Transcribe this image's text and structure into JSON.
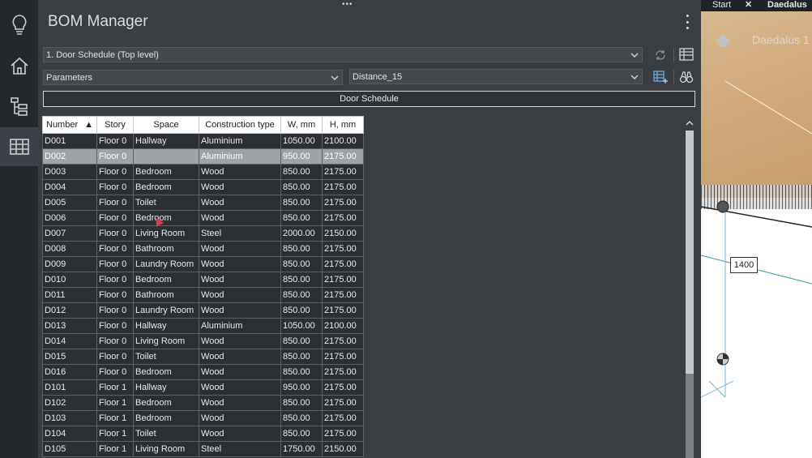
{
  "panel": {
    "title": "BOM Manager"
  },
  "leftbar": {
    "items": [
      {
        "icon": "lightbulb-icon"
      },
      {
        "icon": "home-icon"
      },
      {
        "icon": "tree-icon"
      },
      {
        "icon": "table-icon",
        "active": true
      }
    ]
  },
  "toolbar": {
    "bom_select": "1. Door Schedule (Top level)",
    "param_select": "Parameters",
    "distance_select": "Distance_15",
    "schedule_button": "Door Schedule"
  },
  "table": {
    "columns": [
      "Number",
      "Story",
      "Space",
      "Construction type",
      "W, mm",
      "H, mm"
    ],
    "sort_indicator": "▲",
    "rows": [
      [
        "D001",
        "Floor 0",
        "Hallway",
        "Aluminium",
        "1050.00",
        "2100.00"
      ],
      [
        "D002",
        "Floor 0",
        "",
        "Aluminium",
        "950.00",
        "2175.00"
      ],
      [
        "D003",
        "Floor 0",
        "Bedroom",
        "Wood",
        "850.00",
        "2175.00"
      ],
      [
        "D004",
        "Floor 0",
        "Bedroom",
        "Wood",
        "850.00",
        "2175.00"
      ],
      [
        "D005",
        "Floor 0",
        "Toilet",
        "Wood",
        "850.00",
        "2175.00"
      ],
      [
        "D006",
        "Floor 0",
        "Bedroom",
        "Wood",
        "850.00",
        "2175.00"
      ],
      [
        "D007",
        "Floor 0",
        "Living Room",
        "Steel",
        "2000.00",
        "2150.00"
      ],
      [
        "D008",
        "Floor 0",
        "Bathroom",
        "Wood",
        "850.00",
        "2175.00"
      ],
      [
        "D009",
        "Floor 0",
        "Laundry Room",
        "Wood",
        "850.00",
        "2175.00"
      ],
      [
        "D010",
        "Floor 0",
        "Bedroom",
        "Wood",
        "850.00",
        "2175.00"
      ],
      [
        "D011",
        "Floor 0",
        "Bathroom",
        "Wood",
        "850.00",
        "2175.00"
      ],
      [
        "D012",
        "Floor 0",
        "Laundry Room",
        "Wood",
        "850.00",
        "2175.00"
      ],
      [
        "D013",
        "Floor 0",
        "Hallway",
        "Aluminium",
        "1050.00",
        "2100.00"
      ],
      [
        "D014",
        "Floor 0",
        "Living Room",
        "Wood",
        "850.00",
        "2175.00"
      ],
      [
        "D015",
        "Floor 0",
        "Toilet",
        "Wood",
        "850.00",
        "2175.00"
      ],
      [
        "D016",
        "Floor 0",
        "Bedroom",
        "Wood",
        "850.00",
        "2175.00"
      ],
      [
        "D101",
        "Floor 1",
        "Hallway",
        "Wood",
        "950.00",
        "2175.00"
      ],
      [
        "D102",
        "Floor 1",
        "Bedroom",
        "Wood",
        "850.00",
        "2175.00"
      ],
      [
        "D103",
        "Floor 1",
        "Bedroom",
        "Wood",
        "850.00",
        "2175.00"
      ],
      [
        "D104",
        "Floor 1",
        "Toilet",
        "Wood",
        "850.00",
        "2175.00"
      ],
      [
        "D105",
        "Floor 1",
        "Living Room",
        "Steel",
        "1750.00",
        "2150.00"
      ]
    ],
    "selected_row": 1
  },
  "viewport": {
    "tab_start": "Start",
    "tab_active": "Daedalus",
    "overlay_label": "Daedalus 1",
    "dimension": "1400"
  }
}
